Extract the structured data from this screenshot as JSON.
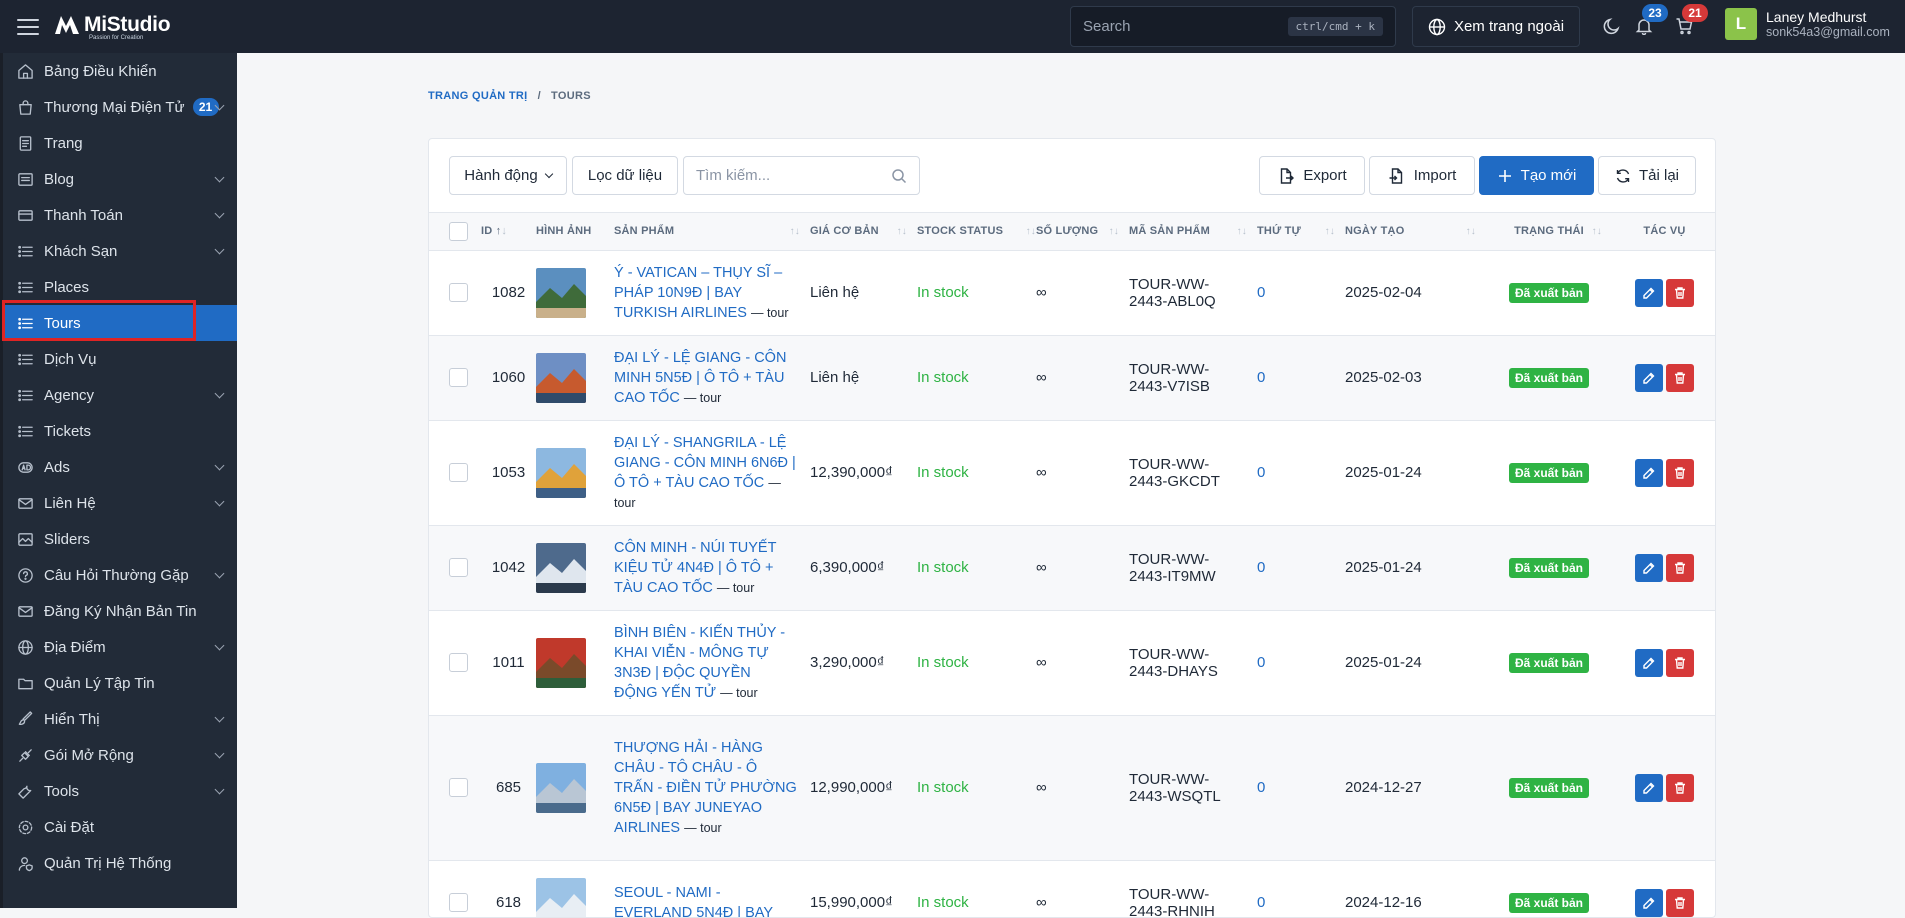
{
  "brand": {
    "name": "MiStudio",
    "tagline": "Passion for Creation"
  },
  "topbar": {
    "search_placeholder": "Search",
    "search_shortcut": "ctrl/cmd + k",
    "view_site_label": "Xem trang ngoài",
    "notifications_count": "23",
    "cart_count": "21",
    "user_initial": "L",
    "user_name": "Laney Medhurst",
    "user_email": "sonk54a3@gmail.com"
  },
  "sidebar": {
    "items": [
      {
        "label": "Bảng Điều Khiển",
        "icon": "home-icon",
        "chevron": false
      },
      {
        "label": "Thương Mại Điện Tử",
        "icon": "shopping-bag-icon",
        "chevron": true,
        "count": "21"
      },
      {
        "label": "Trang",
        "icon": "page-icon",
        "chevron": false
      },
      {
        "label": "Blog",
        "icon": "article-icon",
        "chevron": true
      },
      {
        "label": "Thanh Toán",
        "icon": "credit-card-icon",
        "chevron": true
      },
      {
        "label": "Khách Sạn",
        "icon": "list-icon",
        "chevron": true
      },
      {
        "label": "Places",
        "icon": "list-icon",
        "chevron": false
      },
      {
        "label": "Tours",
        "icon": "list-icon",
        "chevron": false,
        "active": true
      },
      {
        "label": "Dịch Vụ",
        "icon": "list-icon",
        "chevron": false
      },
      {
        "label": "Agency",
        "icon": "list-icon",
        "chevron": true
      },
      {
        "label": "Tickets",
        "icon": "list-icon",
        "chevron": false
      },
      {
        "label": "Ads",
        "icon": "ad-icon",
        "chevron": true
      },
      {
        "label": "Liên Hệ",
        "icon": "mail-icon",
        "chevron": true
      },
      {
        "label": "Sliders",
        "icon": "slider-icon",
        "chevron": false
      },
      {
        "label": "Câu Hỏi Thường Gặp",
        "icon": "help-icon",
        "chevron": true
      },
      {
        "label": "Đăng Ký Nhận Bản Tin",
        "icon": "mail-icon",
        "chevron": false
      },
      {
        "label": "Địa Điểm",
        "icon": "globe-icon",
        "chevron": true
      },
      {
        "label": "Quản Lý Tập Tin",
        "icon": "folder-icon",
        "chevron": false
      },
      {
        "label": "Hiển Thị",
        "icon": "brush-icon",
        "chevron": true
      },
      {
        "label": "Gói Mở Rộng",
        "icon": "plug-icon",
        "chevron": true
      },
      {
        "label": "Tools",
        "icon": "tool-icon",
        "chevron": true
      },
      {
        "label": "Cài Đặt",
        "icon": "settings-icon",
        "chevron": false
      },
      {
        "label": "Quản Trị Hệ Thống",
        "icon": "user-shield-icon",
        "chevron": false
      }
    ]
  },
  "breadcrumb": {
    "root": "TRANG QUẢN TRỊ",
    "current": "TOURS"
  },
  "toolbar": {
    "actions_label": "Hành động",
    "filter_label": "Lọc dữ liệu",
    "search_placeholder": "Tìm kiếm...",
    "export_label": "Export",
    "import_label": "Import",
    "create_label": "Tạo mới",
    "reload_label": "Tải lại"
  },
  "table": {
    "headers": {
      "id": "ID",
      "image": "HÌNH ẢNH",
      "product": "SẢN PHẨM",
      "price": "GIÁ CƠ BẢN",
      "stock": "STOCK STATUS",
      "qty": "SỐ LƯỢNG",
      "sku": "MÃ SẢN PHẨM",
      "order": "THỨ TỰ",
      "created": "NGÀY TẠO",
      "status": "TRẠNG THÁI",
      "actions": "TÁC VỤ"
    },
    "rows": [
      {
        "id": "1082",
        "name": "Ý - VATICAN – THỤY SĨ – PHÁP 10N9Đ | BAY TURKISH AIRLINES",
        "type": "— tour",
        "price": "Liên hệ",
        "stock": "In stock",
        "qty": "∞",
        "sku": "TOUR-WW-2443-ABL0Q",
        "order": "0",
        "created": "2025-02-04",
        "status": "Đã xuất bản",
        "thumb_colors": [
          "#5b8fbf",
          "#3f6b3a",
          "#c9b08a"
        ]
      },
      {
        "id": "1060",
        "name": "ĐẠI LÝ - LỆ GIANG - CÔN MINH 5N5Đ | Ô TÔ + TÀU CAO TỐC",
        "type": "— tour",
        "price": "Liên hệ",
        "stock": "In stock",
        "qty": "∞",
        "sku": "TOUR-WW-2443-V7ISB",
        "order": "0",
        "created": "2025-02-03",
        "status": "Đã xuất bản",
        "thumb_colors": [
          "#6e8fc4",
          "#c75a2e",
          "#2f4b6b"
        ]
      },
      {
        "id": "1053",
        "name": "ĐẠI LÝ - SHANGRILA - LỆ GIANG - CÔN MINH 6N6Đ | Ô TÔ + TÀU CAO TỐC",
        "type": "— tour",
        "price": "12,390,000₫",
        "stock": "In stock",
        "qty": "∞",
        "sku": "TOUR-WW-2443-GKCDT",
        "order": "0",
        "created": "2025-01-24",
        "status": "Đã xuất bản",
        "thumb_colors": [
          "#8db8e0",
          "#e0a23a",
          "#3e5f86"
        ]
      },
      {
        "id": "1042",
        "name": "CÔN MINH - NÚI TUYẾT KIỆU TỬ 4N4Đ | Ô TÔ + TÀU CAO TỐC",
        "type": "— tour",
        "price": "6,390,000₫",
        "stock": "In stock",
        "qty": "∞",
        "sku": "TOUR-WW-2443-IT9MW",
        "order": "0",
        "created": "2025-01-24",
        "status": "Đã xuất bản",
        "thumb_colors": [
          "#4e6a8c",
          "#dfe6ee",
          "#2b3a4c"
        ]
      },
      {
        "id": "1011",
        "name": "BÌNH BIÊN - KIẾN THỦY - KHAI VIỄN - MÔNG TỰ 3N3Đ | ĐỘC QUYỀN ĐỘNG YẾN TỬ",
        "type": "— tour",
        "price": "3,290,000₫",
        "stock": "In stock",
        "qty": "∞",
        "sku": "TOUR-WW-2443-DHAYS",
        "order": "0",
        "created": "2025-01-24",
        "status": "Đã xuất bản",
        "thumb_colors": [
          "#c0392b",
          "#7a4a2a",
          "#2e5e3a"
        ]
      },
      {
        "id": "685",
        "name": "THƯỢNG HẢI - HÀNG CHÂU - TÔ CHÂU - Ô TRẤN - ĐIỀN TỬ PHƯỜNG 6N5Đ | BAY JUNEYAO AIRLINES",
        "type": "— tour",
        "price": "12,990,000₫",
        "stock": "In stock",
        "qty": "∞",
        "sku": "TOUR-WW-2443-WSQTL",
        "order": "0",
        "created": "2024-12-27",
        "status": "Đã xuất bản",
        "thumb_colors": [
          "#7fb0e0",
          "#b9c6d4",
          "#4a6b8c"
        ]
      },
      {
        "id": "618",
        "name": "SEOUL - NAMI - EVERLAND 5N4Đ | BAY",
        "type": "",
        "price": "15,990,000₫",
        "stock": "In stock",
        "qty": "∞",
        "sku": "TOUR-WW-2443-RHNIH",
        "order": "0",
        "created": "2024-12-16",
        "status": "Đã xuất bản",
        "thumb_colors": [
          "#9cc3e6",
          "#e8eef4",
          "#5a7a9a"
        ]
      }
    ]
  },
  "colors": {
    "primary": "#206bc4",
    "success": "#2fb344",
    "danger": "#d63939",
    "topbar": "#1d2431",
    "sidebar": "#222b38"
  }
}
